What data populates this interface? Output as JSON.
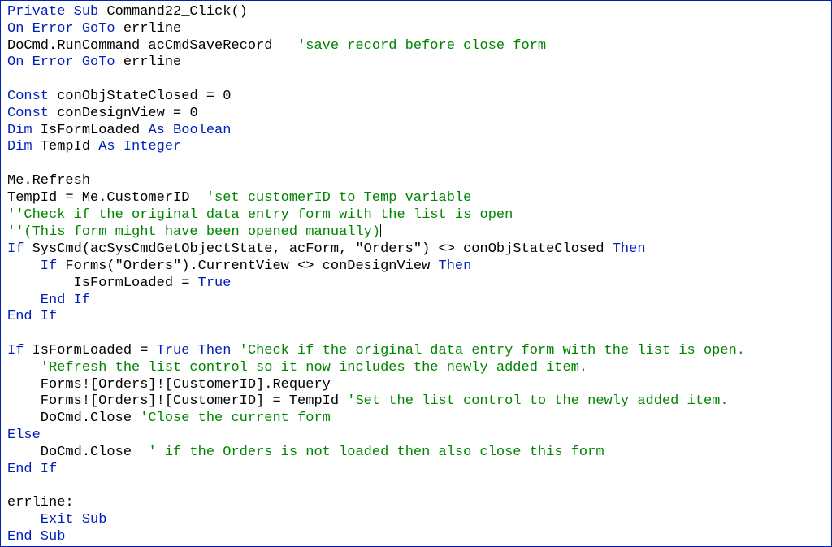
{
  "code": {
    "l1a": "Private Sub",
    "l1b": " Command22_Click()",
    "l2a": "On Error GoTo",
    "l2b": " errline",
    "l3a": "DoCmd.RunCommand acCmdSaveRecord   ",
    "l3b": "'save record before close form",
    "l4a": "On Error GoTo",
    "l4b": " errline",
    "l6a": "Const",
    "l6b": " conObjStateClosed = 0",
    "l7a": "Const",
    "l7b": " conDesignView = 0",
    "l8a": "Dim",
    "l8b": " IsFormLoaded ",
    "l8c": "As Boolean",
    "l9a": "Dim",
    "l9b": " TempId ",
    "l9c": "As Integer",
    "l11": "Me.Refresh",
    "l12a": "TempId = Me.CustomerID  ",
    "l12b": "'set customerID to Temp variable",
    "l13": "''Check if the original data entry form with the list is open",
    "l14": "''(This form might have been opened manually)",
    "l15a": "If",
    "l15b": " SysCmd(acSysCmdGetObjectState, acForm, \"Orders\") <> conObjStateClosed ",
    "l15c": "Then",
    "l16a": "    If",
    "l16b": " Forms(\"Orders\").CurrentView <> conDesignView ",
    "l16c": "Then",
    "l17a": "        IsFormLoaded = ",
    "l17b": "True",
    "l18": "    End If",
    "l19": "End If",
    "l21a": "If",
    "l21b": " IsFormLoaded = ",
    "l21c": "True Then ",
    "l21d": "'Check if the original data entry form with the list is open.",
    "l22": "    'Refresh the list control so it now includes the newly added item.",
    "l23": "    Forms![Orders]![CustomerID].Requery",
    "l24a": "    Forms![Orders]![CustomerID] = TempId ",
    "l24b": "'Set the list control to the newly added item.",
    "l25a": "    DoCmd.Close ",
    "l25b": "'Close the current form",
    "l26": "Else",
    "l27a": "    DoCmd.Close  ",
    "l27b": "' if the Orders is not loaded then also close this form",
    "l28": "End If",
    "l30": "errline:",
    "l31": "    Exit Sub",
    "l32": "End Sub"
  }
}
